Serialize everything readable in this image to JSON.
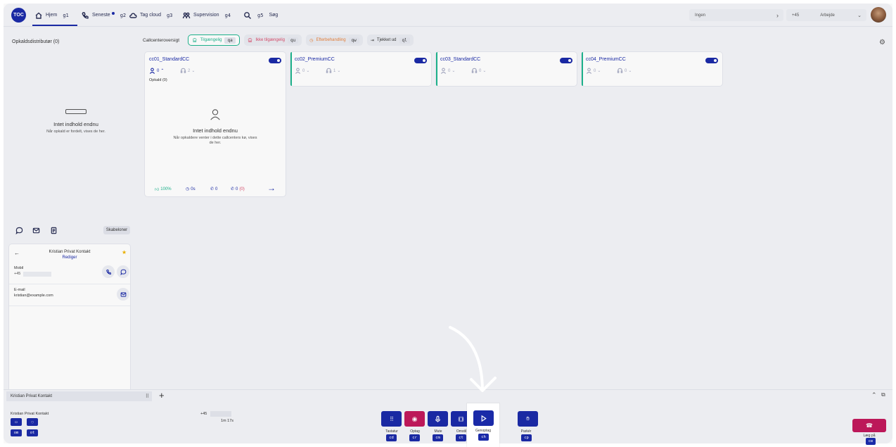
{
  "topbar": {
    "logo": "TOC",
    "nav": [
      {
        "label": "Hjem",
        "key": "g1",
        "icon": "home-icon"
      },
      {
        "label": "Seneste",
        "key": "g2",
        "icon": "phone-icon"
      },
      {
        "label": "Tag cloud",
        "key": "g3",
        "icon": "cloud-icon"
      },
      {
        "label": "Supervision",
        "key": "g4",
        "icon": "supervision-icon"
      },
      {
        "label": "Søg",
        "key": "g5",
        "icon": "search-icon"
      }
    ],
    "status_field": "Ingen",
    "phone_prefix": "+45",
    "work_status": "Arbejde"
  },
  "left": {
    "title": "Opkaldsdistributør (0)",
    "empty_title": "Intet indhold endnu",
    "empty_sub": "Når opkald er fordelt, vises de her."
  },
  "overview": {
    "title": "Callcenteroversigt",
    "filters": [
      {
        "label": "Tilgængelig",
        "key": "qa"
      },
      {
        "label": "Ikke tilgængelig",
        "key": "qu"
      },
      {
        "label": "Efterbehandling",
        "key": "qw"
      },
      {
        "label": "Tjekket ud",
        "key": "ql"
      }
    ]
  },
  "cards": [
    {
      "name": "cc01_StandardCC",
      "agents": "0",
      "queue": "2",
      "calls_label": "Opkald (0)",
      "empty_title": "Intet indhold endnu",
      "empty_sub": "Når opkaldere venter i dette callcenters kø, vises de her.",
      "stat_pct": "100%",
      "stat_time": "0s",
      "stat_calls": "0",
      "stat_missed": "0",
      "stat_missed_extra": "(0)"
    },
    {
      "name": "cc02_PremiumCC",
      "agents": "0",
      "queue": "1"
    },
    {
      "name": "cc03_StandardCC",
      "agents": "0",
      "queue": "0"
    },
    {
      "name": "cc04_PremiumCC",
      "agents": "0",
      "queue": "0"
    }
  ],
  "contact": {
    "templates_label": "Skabeloner",
    "name": "Kristian Privat Kontakt",
    "edit": "Rediger",
    "mobile_label": "Mobil",
    "mobile_value": "+45",
    "email_label": "E-mail",
    "email_value": "kristian@example.com"
  },
  "bottom": {
    "tab_label": "Kristian Privat Kontakt",
    "call_name": "Kristian Privat Kontakt",
    "call_number": "+45",
    "duration": "1m 17s",
    "left_keys": [
      "om",
      "ot"
    ],
    "controls": [
      {
        "label": "Tastatur",
        "key": "cd",
        "icon": "keypad-icon"
      },
      {
        "label": "Optag",
        "key": "cr",
        "icon": "record-icon"
      },
      {
        "label": "Mute",
        "key": "cm",
        "icon": "mic-icon"
      },
      {
        "label": "Omstil",
        "key": "ct",
        "icon": "transfer-icon"
      },
      {
        "label": "Genoptag",
        "key": "ch",
        "icon": "play-icon"
      },
      {
        "label": "Parkér",
        "key": "cp",
        "icon": "park-icon"
      }
    ],
    "hangup_label": "Læg på",
    "hangup_key": "ce"
  },
  "colors": {
    "primary": "#1a2aa8",
    "available": "#1db58e",
    "unavailable": "#d94a6a",
    "after": "#e8813a",
    "hangup": "#c2185b"
  }
}
